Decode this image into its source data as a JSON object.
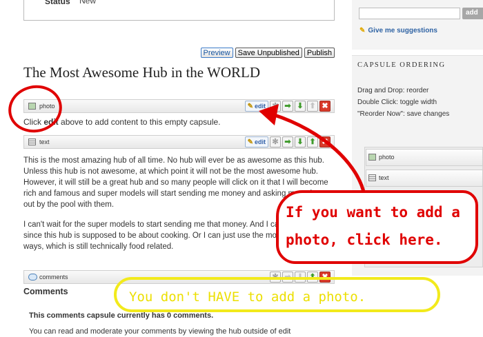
{
  "status": {
    "label": "Status",
    "value": "New"
  },
  "actions": {
    "preview": "Preview",
    "save_unpublished": "Save Unpublished",
    "publish": "Publish"
  },
  "hub": {
    "title": "The Most Awesome Hub in the WORLD"
  },
  "capsules": [
    {
      "name": "photo",
      "edit": "edit"
    },
    {
      "name": "text",
      "edit": "edit"
    },
    {
      "name": "comments"
    }
  ],
  "photo_capsule": {
    "empty_prefix": "Click ",
    "empty_edit": "edit",
    "empty_suffix": " above to add content to this empty capsule."
  },
  "text_capsule": {
    "paragraph_1": "This is the most amazing hub of all time.  No hub will ever be as awesome as this hub.  Unless this hub is not awesome, at which point it will not be the most awesome hub.  However, it will still be a great hub and so many people will click on it that I will become rich and famous and super models will start sending me money and asking me to hang out by the pool with them.",
    "paragraph_2": "I can't wait for the super models to start sending me that money.  And I can cook them since this hub is supposed to be about cooking.  Or I can just use the money in creative ways, which is still technically food related."
  },
  "comments_capsule": {
    "heading": "Comments",
    "count_text": "This comments capsule currently has 0 comments.",
    "moderate_text": "You can read and moderate your comments by viewing the hub outside of edit"
  },
  "sidebar": {
    "add_button": "add",
    "suggestions_link": "Give me suggestions",
    "ordering": {
      "title": "CAPSULE ORDERING",
      "instructions": [
        "Drag and Drop: reorder",
        "Double Click: toggle width",
        "\"Reorder Now\": save changes"
      ],
      "items": [
        "photo",
        "text"
      ]
    }
  },
  "annotations": {
    "red_line_1": "If you want to add a",
    "red_line_2": "photo, click here.",
    "yellow": "You don't HAVE to add a photo."
  },
  "colors": {
    "annotation_red": "#e00000",
    "annotation_yellow": "#ecdf00",
    "link_blue": "#2f63a4",
    "move_arrow_green": "#3e9a2a",
    "delete_red": "#d93a2a"
  }
}
